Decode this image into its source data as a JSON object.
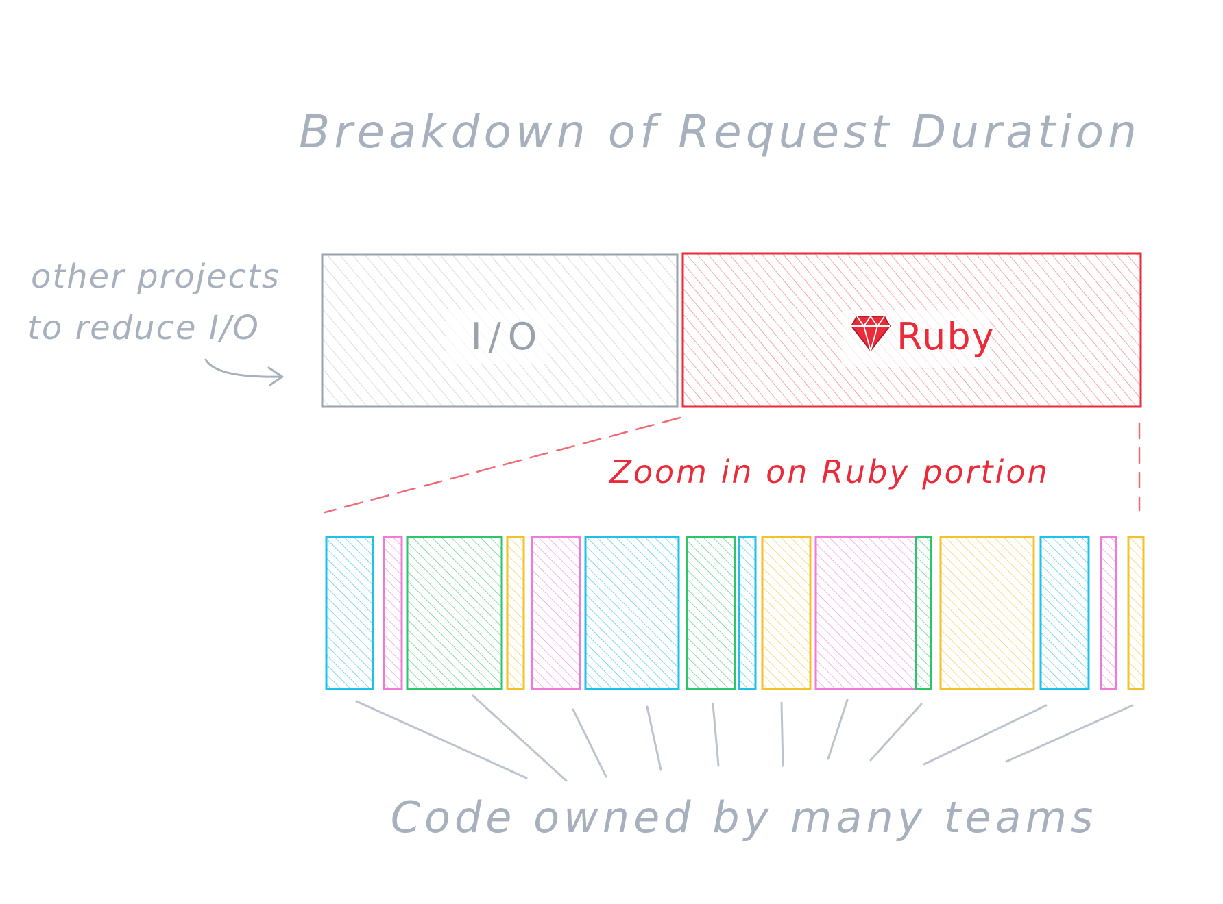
{
  "title": "Breakdown of Request Duration",
  "side_note": {
    "line1": "other projects",
    "line2": "to reduce I/O"
  },
  "top_bar": {
    "io_label": "I/O",
    "ruby_label": "Ruby",
    "ruby_icon": "ruby-gem-icon"
  },
  "zoom_label": "Zoom in on Ruby portion",
  "bottom_label": "Code owned by many teams",
  "colors": {
    "ink": "#a7b0bd",
    "io": "#9aa3ad",
    "ruby": "#ea2b3a",
    "cyan": "#1fc2e6",
    "pink": "#f07ad8",
    "green": "#2ec46a",
    "yellow": "#f2c12b"
  },
  "segments": [
    {
      "team": "cyan"
    },
    {
      "team": "pink"
    },
    {
      "team": "green"
    },
    {
      "team": "yellow"
    },
    {
      "team": "pink"
    },
    {
      "team": "cyan"
    },
    {
      "team": "green"
    },
    {
      "team": "cyan"
    },
    {
      "team": "yellow"
    },
    {
      "team": "pink"
    },
    {
      "team": "green"
    },
    {
      "team": "yellow"
    },
    {
      "team": "cyan"
    },
    {
      "team": "pink"
    },
    {
      "team": "yellow"
    }
  ]
}
